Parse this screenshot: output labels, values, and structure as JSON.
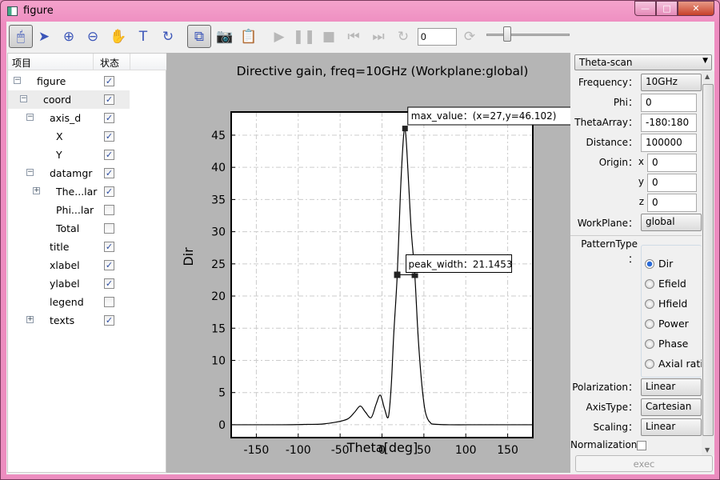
{
  "window": {
    "title": "figure",
    "minimize": "—",
    "maximize": "□",
    "close": "✕"
  },
  "toolbar": {
    "buttons": [
      {
        "name": "mouse-mode-icon",
        "glyph": "🖱",
        "selected": true
      },
      {
        "name": "pointer-icon",
        "glyph": "➤"
      },
      {
        "name": "zoom-in-icon",
        "glyph": "⊕"
      },
      {
        "name": "zoom-out-icon",
        "glyph": "⊖"
      },
      {
        "name": "pan-hand-icon",
        "glyph": "✋"
      },
      {
        "name": "text-icon",
        "glyph": "T"
      },
      {
        "name": "rotate-icon",
        "glyph": "↻"
      },
      {
        "name": "tree-hierarchy-icon",
        "glyph": "⧉",
        "selected": true
      },
      {
        "name": "camera-icon",
        "glyph": "📷"
      },
      {
        "name": "clipboard-camera-icon",
        "glyph": "📋"
      },
      {
        "name": "play-icon",
        "glyph": "▶",
        "disabled": true
      },
      {
        "name": "pause-icon",
        "glyph": "❚❚",
        "disabled": true
      },
      {
        "name": "stop-icon",
        "glyph": "■",
        "disabled": true
      },
      {
        "name": "skip-back-icon",
        "glyph": "⏮",
        "disabled": true
      },
      {
        "name": "skip-forward-icon",
        "glyph": "⏭",
        "disabled": true
      },
      {
        "name": "refresh-icon",
        "glyph": "↻",
        "disabled": true
      }
    ],
    "frame_value": "0",
    "reload_glyph": "⟳",
    "slider_value": 0.25
  },
  "tree": {
    "col_item": "项目",
    "col_state": "状态",
    "rows": [
      {
        "label": "figure",
        "level": 0,
        "expander": "−",
        "checked": true
      },
      {
        "label": "coord",
        "level": 1,
        "expander": "−",
        "checked": true,
        "highlight": true
      },
      {
        "label": "axis_d",
        "level": 2,
        "expander": "−",
        "checked": true
      },
      {
        "label": "X",
        "level": 3,
        "checked": true
      },
      {
        "label": "Y",
        "level": 3,
        "checked": true
      },
      {
        "label": "datamgr",
        "level": 2,
        "expander": "−",
        "checked": true
      },
      {
        "label": "The...lar",
        "level": 3,
        "expander": "+",
        "checked": true
      },
      {
        "label": "Phi...lar",
        "level": 3,
        "checked": false
      },
      {
        "label": "Total",
        "level": 3,
        "checked": false
      },
      {
        "label": "title",
        "level": 2,
        "checked": true
      },
      {
        "label": "xlabel",
        "level": 2,
        "checked": true
      },
      {
        "label": "ylabel",
        "level": 2,
        "checked": true
      },
      {
        "label": "legend",
        "level": 2,
        "checked": false
      },
      {
        "label": "texts",
        "level": 2,
        "expander": "+",
        "checked": true
      }
    ]
  },
  "chart_data": {
    "type": "line",
    "title": "Directive gain, freq=10GHz (Workplane:global)",
    "xlabel": "Theta[deg]",
    "ylabel": "Dir",
    "xlim": [
      -180,
      180
    ],
    "ylim": [
      -2,
      48.6
    ],
    "xticks": [
      -150,
      -100,
      -50,
      0,
      50,
      100,
      150
    ],
    "yticks": [
      0,
      5,
      10,
      15,
      20,
      25,
      30,
      35,
      40,
      45
    ],
    "grid": true,
    "series": [
      {
        "x": [
          -180,
          -120,
          -90,
          -72,
          -55,
          -41,
          -33,
          -26,
          -20,
          -13,
          -7,
          -2,
          3,
          7.6,
          11,
          14,
          18.2,
          22,
          25,
          27,
          29,
          32,
          35,
          39.2,
          43,
          47,
          51,
          54.5,
          58,
          61,
          80,
          120,
          180
        ],
        "y": [
          0,
          0,
          0.05,
          0.1,
          0.4,
          0.9,
          1.9,
          2.9,
          2.0,
          1.1,
          3.2,
          4.6,
          2.5,
          1.2,
          6,
          14,
          23.3,
          36,
          43.5,
          46.1,
          44,
          37,
          30,
          23.2,
          14,
          7,
          2.5,
          0.9,
          0.3,
          0.1,
          0,
          0,
          0
        ],
        "color": "#000000"
      }
    ],
    "annotations": [
      {
        "label": "max_value：(x=27,y=46.102)",
        "x": 27,
        "y": 46.102
      },
      {
        "label": "peak_width：21.1453",
        "x1": 18.2,
        "x2": 39.2,
        "y": 23.3
      }
    ]
  },
  "panel": {
    "mode": "Theta-scan",
    "frequency_label": "Frequency：",
    "frequency": "10GHz",
    "phi_label": "Phi：",
    "phi": "0",
    "theta_label": "ThetaArray：",
    "theta": "-180:180",
    "distance_label": "Distance：",
    "distance": "100000",
    "origin_label": "Origin：",
    "ox_label": "x",
    "ox": "0",
    "oy_label": "y",
    "oy": "0",
    "oz_label": "z",
    "oz": "0",
    "workplane_label": "WorkPlane：",
    "workplane": "global",
    "pattern_label": "PatternType",
    "pattern_colon": "：",
    "patterns": [
      {
        "label": "Dir",
        "selected": true
      },
      {
        "label": "Efield"
      },
      {
        "label": "Hfield"
      },
      {
        "label": "Power"
      },
      {
        "label": "Phase"
      },
      {
        "label": "Axial ratio"
      }
    ],
    "polarization_label": "Polarization：",
    "polarization": "Linear",
    "axistype_label": "AxisType：",
    "axistype": "Cartesian",
    "scaling_label": "Scaling：",
    "scaling": "Linear",
    "normalization_label": "Normalization",
    "normalization": false,
    "exec": "exec"
  }
}
